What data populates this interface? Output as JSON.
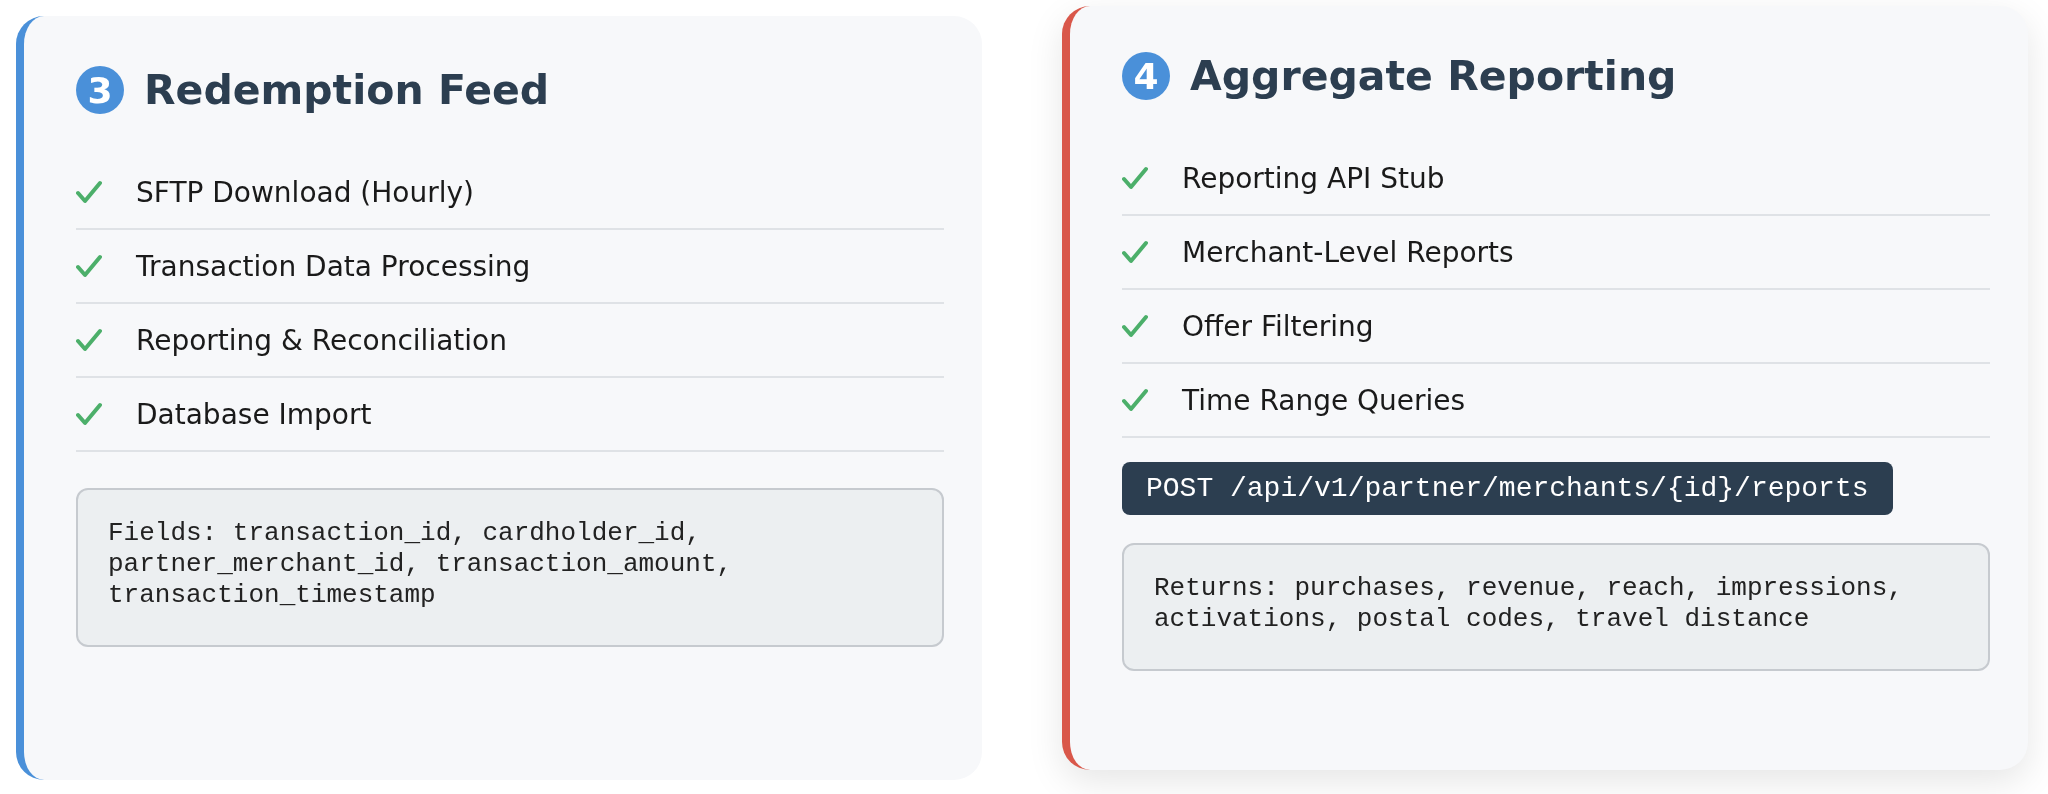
{
  "cards": [
    {
      "number": "3",
      "title": "Redemption Feed",
      "color": "#4a90d9",
      "raised": false,
      "items": [
        "SFTP Download (Hourly)",
        "Transaction Data Processing",
        "Reporting & Reconciliation",
        "Database Import"
      ],
      "blocks": [
        {
          "kind": "note",
          "text": "Fields: transaction_id, cardholder_id,\npartner_merchant_id, transaction_amount,\ntransaction_timestamp"
        }
      ]
    },
    {
      "number": "4",
      "title": "Aggregate Reporting",
      "color": "#d9574a",
      "raised": true,
      "items": [
        "Reporting API Stub",
        "Merchant-Level Reports",
        "Offer Filtering",
        "Time Range Queries"
      ],
      "blocks": [
        {
          "kind": "endpoint",
          "text": "POST /api/v1/partner/merchants/{id}/reports"
        },
        {
          "kind": "note",
          "text": "Returns: purchases, revenue, reach, impressions,\nactivations, postal codes, travel distance"
        }
      ]
    }
  ]
}
